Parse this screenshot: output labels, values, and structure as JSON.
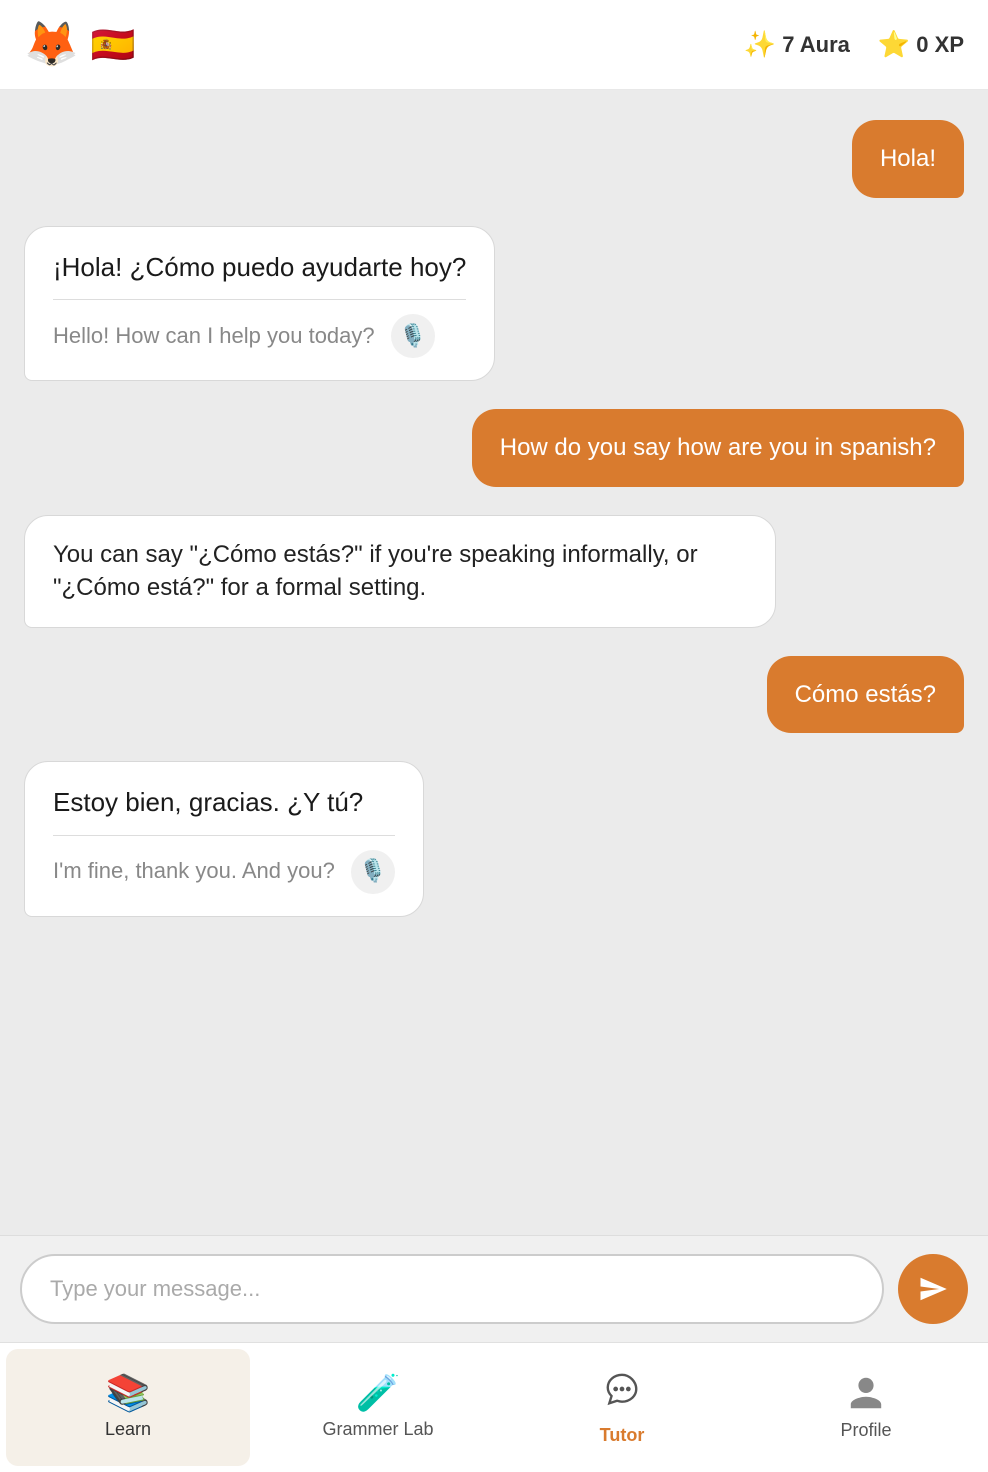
{
  "header": {
    "fox_emoji": "🦊",
    "flag_emoji": "🇪🇸",
    "aura_icon": "✨",
    "aura_value": "7 Aura",
    "xp_icon": "⭐",
    "xp_value": "0 XP"
  },
  "messages": [
    {
      "id": 1,
      "type": "user",
      "text": "Hola!"
    },
    {
      "id": 2,
      "type": "bot",
      "primary": "¡Hola! ¿Cómo puedo ayudarte hoy?",
      "translation": "Hello! How can I help you today?",
      "has_speaker": true
    },
    {
      "id": 3,
      "type": "user",
      "text": "How do you say how are you in spanish?"
    },
    {
      "id": 4,
      "type": "bot",
      "primary": "You can say \"¿Cómo estás?\" if you're speaking informally, or \"¿Cómo está?\" for a formal setting.",
      "translation": null,
      "has_speaker": false
    },
    {
      "id": 5,
      "type": "user",
      "text": "Cómo estás?"
    },
    {
      "id": 6,
      "type": "bot",
      "primary": "Estoy bien, gracias. ¿Y tú?",
      "translation": "I'm fine, thank you. And you?",
      "has_speaker": true
    }
  ],
  "input": {
    "placeholder": "Type your message..."
  },
  "nav": {
    "items": [
      {
        "id": "learn",
        "label": "Learn",
        "icon": "📚",
        "active": false,
        "active_class": "active-learn"
      },
      {
        "id": "grammar",
        "label": "Grammer Lab",
        "icon": "🧪",
        "active": false
      },
      {
        "id": "tutor",
        "label": "Tutor",
        "icon": "chat",
        "active": true,
        "active_class": "active-tutor"
      },
      {
        "id": "profile",
        "label": "Profile",
        "icon": "person",
        "active": false
      }
    ]
  }
}
